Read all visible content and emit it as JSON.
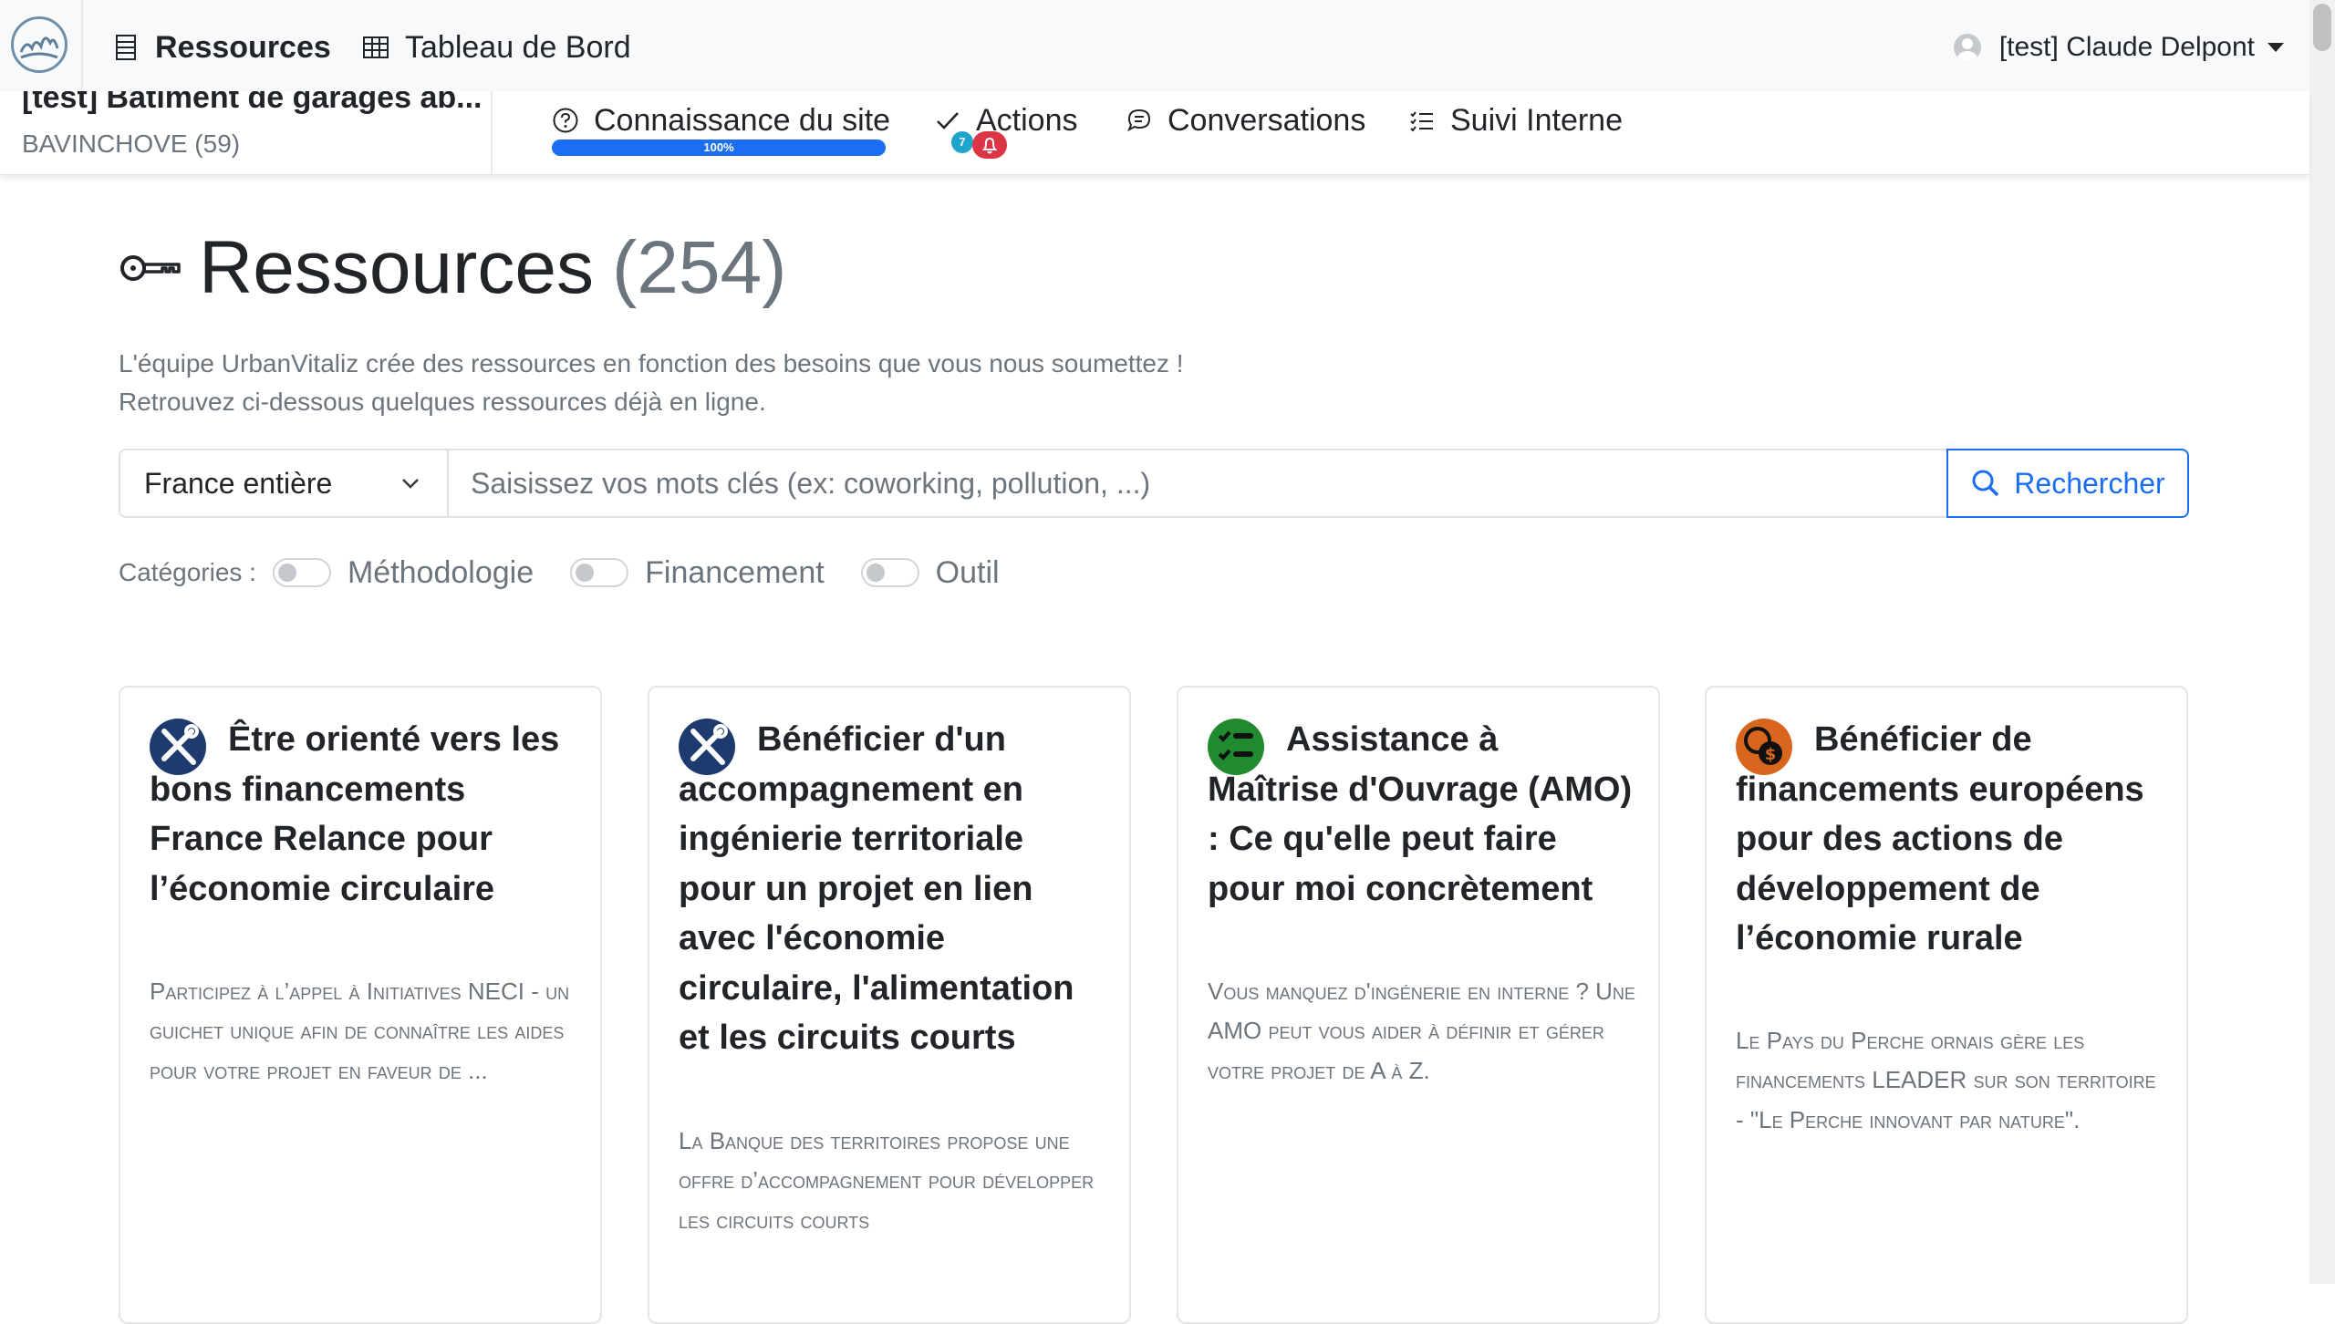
{
  "topbar": {
    "nav": [
      {
        "label": "Ressources",
        "icon": "list-icon"
      },
      {
        "label": "Tableau de Bord",
        "icon": "table-icon"
      }
    ],
    "user": {
      "name": "[test] Claude Delpont"
    }
  },
  "project": {
    "title": "[test] Batiment de garages ab...",
    "location": "BAVINCHOVE (59)",
    "tabs": [
      {
        "label": "Connaissance du site",
        "icon": "question-circle-icon"
      },
      {
        "label": "Actions",
        "icon": "check-icon"
      },
      {
        "label": "Conversations",
        "icon": "chat-icon"
      },
      {
        "label": "Suivi Interne",
        "icon": "list-check-icon"
      }
    ],
    "progress": {
      "value": 100,
      "label": "100%"
    },
    "actions_badge": "7"
  },
  "main": {
    "title": "Ressources",
    "count": "(254)",
    "intro_line1": "L'équipe UrbanVitaliz crée des ressources en fonction des besoins que vous nous soumettez !",
    "intro_line2": "Retrouvez ci-dessous quelques ressources déjà en ligne.",
    "search": {
      "region": "France entière",
      "placeholder": "Saisissez vos mots clés (ex: coworking, pollution, ...)",
      "button": "Rechercher"
    },
    "categories_label": "Catégories :",
    "categories": [
      "Méthodologie",
      "Financement",
      "Outil"
    ]
  },
  "cards": [
    {
      "icon": "tools-icon",
      "icon_color": "#1e3a6e",
      "title": "Être orienté vers les bons financements France Relance pour l’économie circulaire",
      "desc": "Participez à l’appel à Initiatives NECI - un guichet unique afin de connaître les aides pour votre projet en faveur de ..."
    },
    {
      "icon": "tools-icon",
      "icon_color": "#1e3a6e",
      "title": "Bénéficier d'un accompagnement en ingénierie territoriale pour un projet en lien avec l'économie circulaire, l'alimentation et les circuits courts",
      "desc": "La Banque des territoires propose une offre d’accompagnement pour développer les circuits courts"
    },
    {
      "icon": "checklist-icon",
      "icon_color": "#1f8a2e",
      "title": "Assistance à Maîtrise d'Ouvrage (AMO) : Ce qu'elle peut faire pour moi concrètement",
      "desc": "Vous manquez d'ingénerie en interne ? Une AMO peut vous aider à définir et gérer votre projet de A à Z."
    },
    {
      "icon": "euro-dollar-icon",
      "icon_color": "#d9661f",
      "title": "Bénéficier de financements européens pour des actions de développement de l’économie rurale",
      "desc": "Le Pays du Perche ornais gère les financements LEADER sur son territoire - \"Le Perche innovant par nature\"."
    }
  ]
}
